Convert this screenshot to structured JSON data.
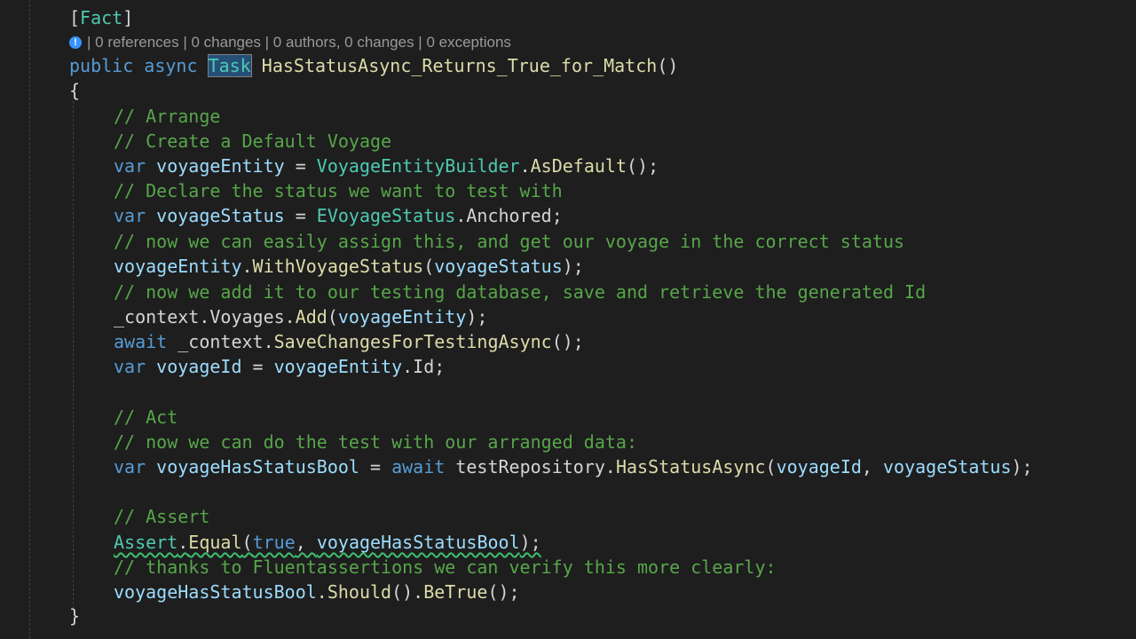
{
  "editor": {
    "attribute_open": "[",
    "attribute_name": "Fact",
    "attribute_close": "]",
    "codelens": "| 0 references | 0 changes | 0 authors, 0 changes | 0 exceptions",
    "signature": {
      "public": "public",
      "async": "async",
      "return_type": "Task",
      "method_name": "HasStatusAsync_Returns_True_for_Match",
      "parens": "()"
    },
    "open_brace": "{",
    "close_brace": "}",
    "arrange_comment": "// Arrange",
    "create_comment": "// Create a Default Voyage",
    "line_entity": {
      "var": "var",
      "name": "voyageEntity",
      "eq": " = ",
      "builder": "VoyageEntityBuilder",
      "dot": ".",
      "method": "AsDefault",
      "tail": "();"
    },
    "declare_comment": "// Declare the status we want to test with",
    "line_status": {
      "var": "var",
      "name": "voyageStatus",
      "eq": " = ",
      "enum": "EVoyageStatus",
      "dot": ".",
      "member": "Anchored",
      "tail": ";"
    },
    "assign_comment": "// now we can easily assign this, and get our voyage in the correct status",
    "line_with": {
      "target": "voyageEntity",
      "dot": ".",
      "method": "WithVoyageStatus",
      "open": "(",
      "arg": "voyageStatus",
      "close": ");"
    },
    "add_comment": "// now we add it to our testing database, save and retrieve the generated Id",
    "line_add": {
      "ctx": "_context",
      "dot1": ".",
      "prop": "Voyages",
      "dot2": ".",
      "method": "Add",
      "open": "(",
      "arg": "voyageEntity",
      "close": ");"
    },
    "line_save": {
      "await": "await",
      "ctx": " _context",
      "dot": ".",
      "method": "SaveChangesForTestingAsync",
      "tail": "();"
    },
    "line_id": {
      "var": "var",
      "name": "voyageId",
      "eq": " = ",
      "target": "voyageEntity",
      "dot": ".",
      "prop": "Id",
      "tail": ";"
    },
    "act_comment": "// Act",
    "act_detail_comment": "// now we can do the test with our arranged data:",
    "line_act": {
      "var": "var",
      "name": "voyageHasStatusBool",
      "eq": " = ",
      "await": "await",
      "repo": " testRepository",
      "dot": ".",
      "method": "HasStatusAsync",
      "open": "(",
      "arg1": "voyageId",
      "comma": ", ",
      "arg2": "voyageStatus",
      "close": ");"
    },
    "assert_comment": "// Assert",
    "line_assert": {
      "cls": "Assert",
      "dot": ".",
      "method": "Equal",
      "open": "(",
      "bool": "true",
      "comma": ", ",
      "arg": "voyageHasStatusBool",
      "close": ");"
    },
    "fluent_comment": "// thanks to Fluentassertions we can verify this more clearly:",
    "line_should": {
      "target": "voyageHasStatusBool",
      "dot1": ".",
      "should": "Should",
      "mid": "().",
      "betrue": "BeTrue",
      "tail": "();"
    }
  },
  "colors": {
    "background": "#1e1e1e",
    "keyword": "#569cd6",
    "comment": "#57a64a",
    "type": "#4ec9b0",
    "method": "#dcdcaa",
    "variable": "#9cdcfe",
    "plain": "#d4d4d4"
  },
  "icons": {
    "codelens_info": "info-icon"
  }
}
